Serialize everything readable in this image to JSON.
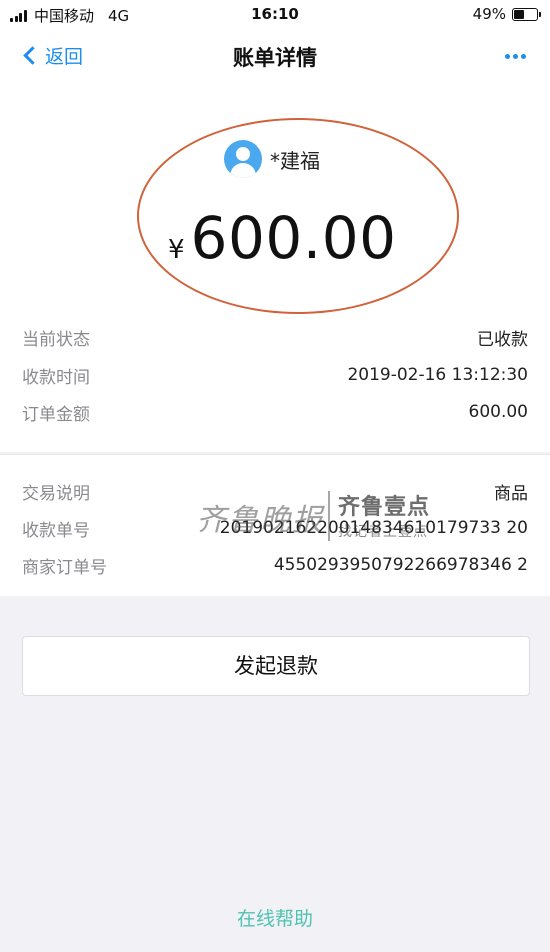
{
  "status_bar": {
    "carrier": "中国移动",
    "network": "4G",
    "time": "16:10",
    "battery_percent_label": "49%",
    "battery_level": 0.49
  },
  "nav": {
    "back_label": "返回",
    "title": "账单详情",
    "more_icon": "more-dots-icon",
    "accent_color": "#1d8ef0"
  },
  "payee": {
    "avatar_icon": "user-avatar-icon",
    "name": "*建福"
  },
  "amount": {
    "currency_symbol": "¥",
    "value": "600.00"
  },
  "details_primary": [
    {
      "label": "当前状态",
      "value": "已收款"
    },
    {
      "label": "收款时间",
      "value": "2019-02-16 13:12:30"
    },
    {
      "label": "订单金额",
      "value": "600.00"
    }
  ],
  "details_secondary": [
    {
      "label": "交易说明",
      "value": "商品"
    },
    {
      "label": "收款单号",
      "value": "20190216220014834610179733 20"
    },
    {
      "label": "商家订单号",
      "value": "4550293950792266978346 2"
    }
  ],
  "watermark": {
    "brand": "齐鲁壹点",
    "tagline": "找记者上壹点"
  },
  "actions": {
    "refund_label": "发起退款",
    "help_label": "在线帮助",
    "help_color": "#4ec2b3"
  }
}
